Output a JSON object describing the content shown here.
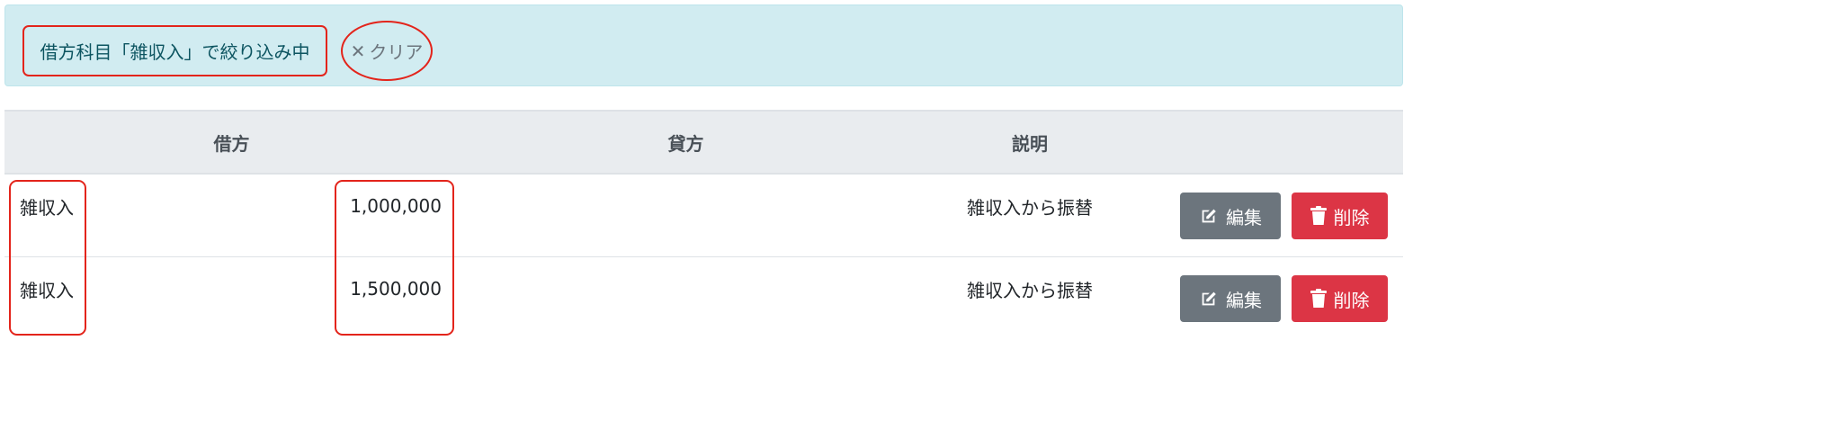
{
  "filter": {
    "label": "借方科目「雑収入」で絞り込み中",
    "clear_label": "クリア",
    "clear_icon": "times-icon"
  },
  "table": {
    "headers": {
      "debit": "借方",
      "credit": "貸方",
      "description": "説明"
    },
    "rows": [
      {
        "debit_account": "雑収入",
        "debit_amount": "1,000,000",
        "description": "雑収入から振替",
        "edit_label": "編集",
        "delete_label": "削除"
      },
      {
        "debit_account": "雑収入",
        "debit_amount": "1,500,000",
        "description": "雑収入から振替",
        "edit_label": "編集",
        "delete_label": "削除"
      }
    ]
  },
  "colors": {
    "alert_bg": "#d1ecf1",
    "alert_text": "#0c5460",
    "edit_button": "#6c757d",
    "delete_button": "#dc3545",
    "highlight": "#e3241b"
  },
  "icons": {
    "edit": "edit-icon",
    "delete": "trash-icon"
  }
}
